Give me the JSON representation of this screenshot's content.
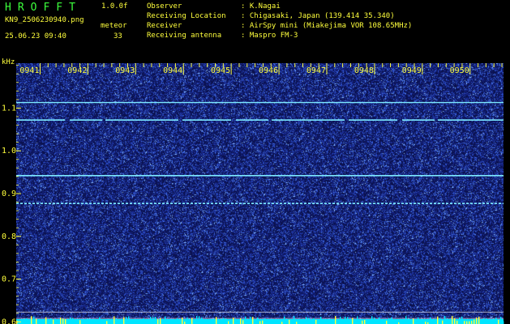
{
  "header": {
    "app_title": "HROFFT",
    "version": "1.0.0f",
    "filename": "KN9_2506230940.png",
    "timestamp": "25.06.23 09:40",
    "mode": "meteor",
    "count": "33",
    "info": [
      {
        "label": "Observer",
        "value": ": K.Nagai"
      },
      {
        "label": "Receiving Location",
        "value": ": Chigasaki, Japan (139.414 35.340)"
      },
      {
        "label": "Receiver",
        "value": ": AirSpy mini (Miakejima VOR 108.65MHz)"
      },
      {
        "label": "Receiving antenna",
        "value": ": Maspro FM-3"
      }
    ]
  },
  "colors": {
    "background": "#000000",
    "plot_bg": "#0b1250",
    "noise": "#3a62e8",
    "trace": "#7ce8ff",
    "text": "#ffff3c",
    "title": "#3cff3c",
    "grid": "#ffffff",
    "baseline": "#00e5ff"
  },
  "chart_data": {
    "type": "heatmap",
    "title": "",
    "ylabel": "kHz",
    "xlabel": "",
    "x_ticks": [
      "0941",
      "0942",
      "0943",
      "0944",
      "0945",
      "0946",
      "0947",
      "0948",
      "0949",
      "0950"
    ],
    "x_range": [
      940.5,
      950.7
    ],
    "y_ticks": [
      1.1,
      1.0,
      0.9,
      0.8,
      0.7,
      0.6
    ],
    "y_tick_labels": [
      "1.1",
      "1.0",
      "0.9",
      "0.8",
      "0.7",
      "0.6"
    ],
    "ylim": [
      0.595,
      1.205
    ],
    "horizontal_traces_khz": [
      1.113,
      1.072,
      0.942,
      0.877
    ],
    "reference_lines_khz": [
      0.623,
      0.608
    ]
  }
}
